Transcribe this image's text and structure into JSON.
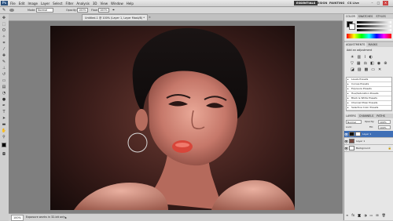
{
  "app": {
    "logo": "Ps",
    "menus": [
      "File",
      "Edit",
      "Image",
      "Layer",
      "Select",
      "Filter",
      "Analysis",
      "3D",
      "View",
      "Window",
      "Help"
    ],
    "workspaces": [
      "ESSENTIALS",
      "DESIGN",
      "PAINTING"
    ],
    "cs_live": "CS Live",
    "window_buttons": [
      "–",
      "□",
      "✕"
    ]
  },
  "options_bar": {
    "mode_label": "Mode:",
    "mode_value": "Normal",
    "opacity_label": "Opacity:",
    "opacity_value": "100%",
    "flow_label": "Flow:",
    "flow_value": "100%"
  },
  "document": {
    "active_tab": "Untitled-1 @ 100% (Layer 1, Layer Mask/8) *",
    "other_tab": "×",
    "zoom": "100%",
    "status": "Exposure works in 32-bit only"
  },
  "panels": {
    "color_tabs": [
      "COLOR",
      "SWATCHES",
      "STYLES"
    ],
    "adjust_tabs": [
      "ADJUSTMENTS",
      "MASKS"
    ],
    "adjust_heading": "Add an adjustment",
    "presets": [
      "Levels Presets",
      "Curves Presets",
      "Exposure Presets",
      "Hue/Saturation Presets",
      "Black & White Presets",
      "Channel Mixer Presets",
      "Selective Color Presets"
    ],
    "layers_tabs": [
      "LAYERS",
      "CHANNELS",
      "PATHS"
    ],
    "blend_mode": "Normal",
    "opacity_label": "Opacity:",
    "opacity_value": "100%",
    "lock_label": "Lock:",
    "fill_label": "Fill:",
    "fill_value": "100%",
    "layers": [
      {
        "name": "Layer 1",
        "selected": true
      },
      {
        "name": "Layer 1",
        "selected": false
      },
      {
        "name": "Background",
        "selected": false
      }
    ]
  },
  "colors": {
    "accent": "#3f6fb6",
    "workspace_active": "#3b3b3b"
  }
}
